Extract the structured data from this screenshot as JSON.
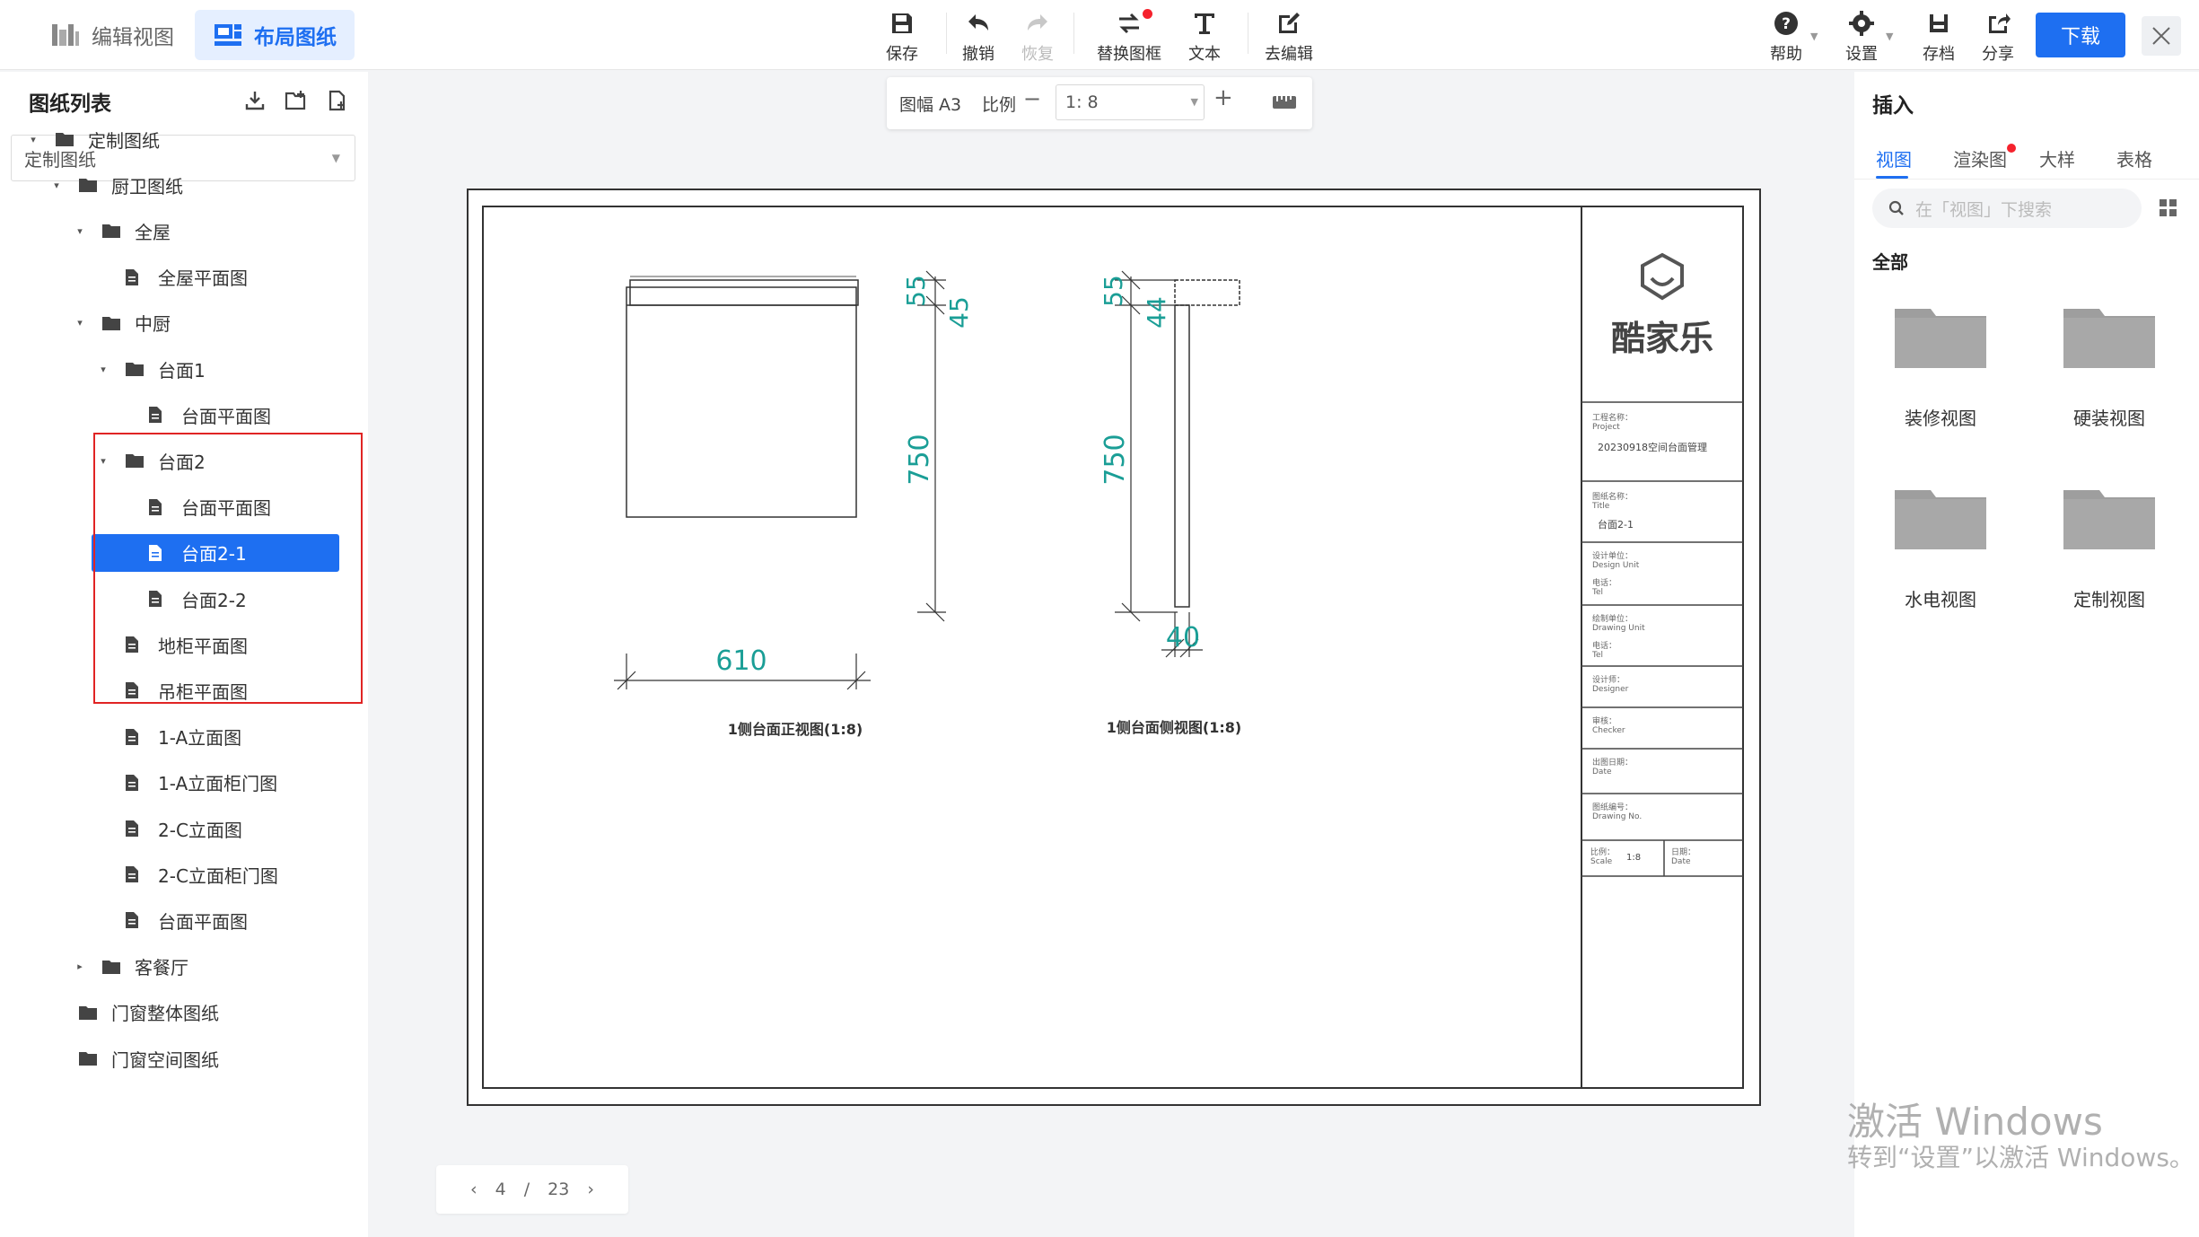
{
  "topbar": {
    "mode_tabs": [
      {
        "label": "编辑视图",
        "active": false
      },
      {
        "label": "布局图纸",
        "active": true
      }
    ],
    "tools": {
      "save": "保存",
      "undo": "撤销",
      "redo": "恢复",
      "replace_frame": "替换图框",
      "text": "文本",
      "go_edit": "去编辑"
    },
    "right": {
      "help": "帮助",
      "settings": "设置",
      "archive": "存档",
      "share": "分享",
      "download": "下载"
    }
  },
  "left_panel": {
    "title": "图纸列表",
    "select_value": "定制图纸",
    "tree": [
      {
        "label": "定制图纸",
        "type": "folder",
        "expanded": true
      },
      {
        "label": "厨卫图纸",
        "type": "folder",
        "expanded": true
      },
      {
        "label": "全屋",
        "type": "folder",
        "expanded": true
      },
      {
        "label": "全屋平面图",
        "type": "file"
      },
      {
        "label": "中厨",
        "type": "folder",
        "expanded": true
      },
      {
        "label": "台面1",
        "type": "folder",
        "expanded": true
      },
      {
        "label": "台面平面图",
        "type": "file"
      },
      {
        "label": "台面2",
        "type": "folder",
        "expanded": true
      },
      {
        "label": "台面平面图",
        "type": "file"
      },
      {
        "label": "台面2-1",
        "type": "file",
        "selected": true
      },
      {
        "label": "台面2-2",
        "type": "file"
      },
      {
        "label": "地柜平面图",
        "type": "file"
      },
      {
        "label": "吊柜平面图",
        "type": "file"
      },
      {
        "label": "1-A立面图",
        "type": "file"
      },
      {
        "label": "1-A立面柜门图",
        "type": "file"
      },
      {
        "label": "2-C立面图",
        "type": "file"
      },
      {
        "label": "2-C立面柜门图",
        "type": "file"
      },
      {
        "label": "台面平面图",
        "type": "file"
      },
      {
        "label": "客餐厅",
        "type": "folder",
        "expanded": false
      },
      {
        "label": "门窗整体图纸",
        "type": "folder"
      },
      {
        "label": "门窗空间图纸",
        "type": "folder"
      }
    ]
  },
  "scale_bar": {
    "paper": "图幅 A3",
    "ratio_label": "比例",
    "ratio_value": "1: 8"
  },
  "drawing": {
    "front_view": {
      "caption": "1侧台面正视图(1:8)",
      "dim_width": "610",
      "dim_height": "750",
      "dim_top1": "55",
      "dim_top2": "45"
    },
    "side_view": {
      "caption": "1侧台面侧视图(1:8)",
      "dim_height": "750",
      "dim_top1": "55",
      "dim_top2": "44",
      "dim_width": "40"
    },
    "title_block": {
      "brand": "酷家乐",
      "project_label": "工程名称：",
      "project_sub": "Project",
      "project_value": "20230918空间台面管理",
      "drawing_name_label": "图纸名称：",
      "drawing_name_sub": "Title",
      "drawing_name_value": "台面2-1",
      "design_unit_label": "设计单位：",
      "design_unit_sub": "Design Unit",
      "designer_label": "电话：",
      "designer_sub": "Tel",
      "drawer_label": "绘制单位：",
      "drawer_sub": "Drawing Unit",
      "tel_label": "电话：",
      "tel_sub": "Tel",
      "audit_label": "设计师：",
      "audit_sub": "Designer",
      "checker_label": "审核：",
      "checker_sub": "Checker",
      "date_label": "出图日期：",
      "date_sub": "Date",
      "num_label": "图纸编号：",
      "num_sub": "Drawing No.",
      "scale_label": "比例：",
      "scale_sub": "Scale",
      "scale_value": "1:8",
      "remark_label": "日期：",
      "remark_sub": "Date"
    }
  },
  "pager": {
    "current": "4",
    "sep": "/",
    "total": "23"
  },
  "right_panel": {
    "title": "插入",
    "tabs": [
      {
        "label": "视图",
        "active": true
      },
      {
        "label": "渲染图",
        "dot": true
      },
      {
        "label": "大样"
      },
      {
        "label": "表格"
      }
    ],
    "search_placeholder": "在「视图」下搜索",
    "section": "全部",
    "items": [
      "装修视图",
      "硬装视图",
      "水电视图",
      "定制视图"
    ]
  },
  "watermark": {
    "line1": "激活 Windows",
    "line2": "转到“设置”以激活 Windows。"
  },
  "colors": {
    "accent": "#1e6ff1",
    "dimension": "#1a9e96",
    "highlight": "#e02424",
    "dot": "#f5222d"
  }
}
